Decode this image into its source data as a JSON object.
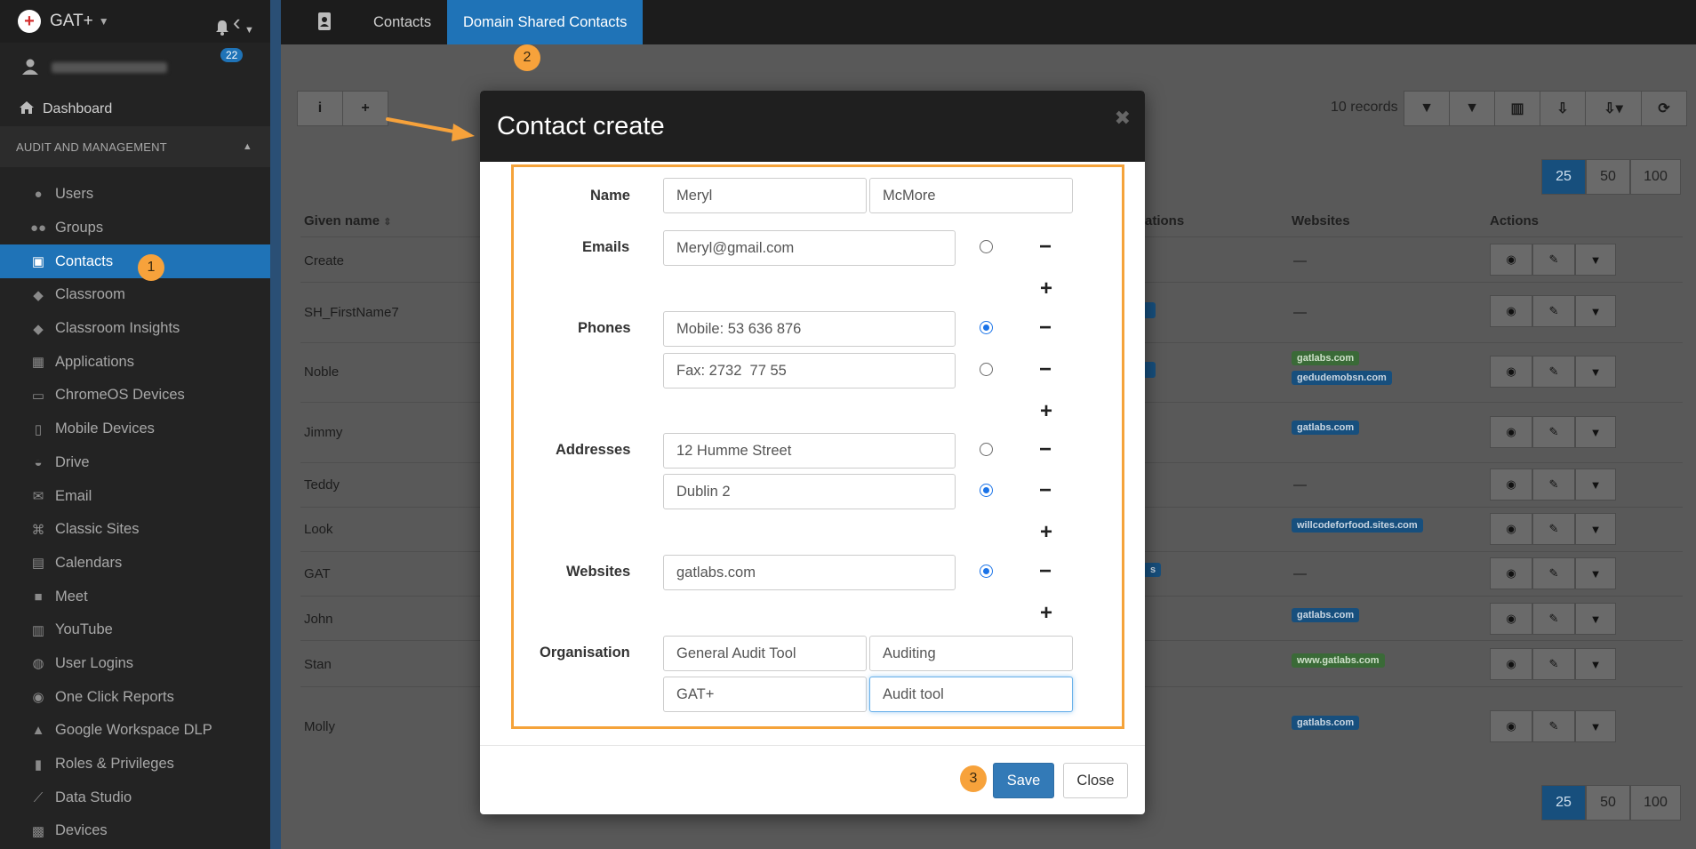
{
  "app": {
    "name": "GAT+",
    "notifications": "22"
  },
  "sidebar": {
    "dashboard": "Dashboard",
    "section": "AUDIT AND MANAGEMENT",
    "items": [
      {
        "label": "Users",
        "icon": "user-icon"
      },
      {
        "label": "Groups",
        "icon": "groups-icon"
      },
      {
        "label": "Contacts",
        "icon": "contact-card-icon",
        "active": true
      },
      {
        "label": "Classroom",
        "icon": "graduation-cap-icon"
      },
      {
        "label": "Classroom Insights",
        "icon": "classroom-insights-icon"
      },
      {
        "label": "Applications",
        "icon": "grid-icon"
      },
      {
        "label": "ChromeOS Devices",
        "icon": "laptop-icon"
      },
      {
        "label": "Mobile Devices",
        "icon": "mobile-icon"
      },
      {
        "label": "Drive",
        "icon": "drive-icon"
      },
      {
        "label": "Email",
        "icon": "envelope-icon"
      },
      {
        "label": "Classic Sites",
        "icon": "sitemap-icon"
      },
      {
        "label": "Calendars",
        "icon": "calendar-icon"
      },
      {
        "label": "Meet",
        "icon": "video-icon"
      },
      {
        "label": "YouTube",
        "icon": "film-icon"
      },
      {
        "label": "User Logins",
        "icon": "globe-icon"
      },
      {
        "label": "One Click Reports",
        "icon": "eye-icon"
      },
      {
        "label": "Google Workspace DLP",
        "icon": "flask-icon"
      },
      {
        "label": "Roles & Privileges",
        "icon": "lock-icon"
      },
      {
        "label": "Data Studio",
        "icon": "line-chart-icon"
      },
      {
        "label": "Devices",
        "icon": "chip-icon"
      }
    ]
  },
  "topbar": {
    "tabs": [
      "Contacts",
      "Domain Shared Contacts"
    ]
  },
  "main": {
    "records": "10 records",
    "page_sizes": [
      "25",
      "50",
      "100"
    ],
    "columns": {
      "given_name": "Given name",
      "organisations": "ations",
      "websites": "Websites",
      "actions": "Actions"
    },
    "rows": [
      {
        "name": "Create",
        "website": "—"
      },
      {
        "name": "SH_FirstName7",
        "website": "—"
      },
      {
        "name": "Noble",
        "websites": [
          "gatlabs.com",
          "gedudemobsn.com"
        ]
      },
      {
        "name": "Jimmy",
        "websites": [
          "gatlabs.com"
        ]
      },
      {
        "name": "Teddy",
        "website": "—"
      },
      {
        "name": "Look",
        "websites": [
          "willcodeforfood.sites.com"
        ]
      },
      {
        "name": "GAT",
        "website": "—"
      },
      {
        "name": "John",
        "websites": [
          "gatlabs.com"
        ]
      },
      {
        "name": "Stan",
        "websites": [
          "www.gatlabs.com"
        ]
      },
      {
        "name": "Molly",
        "websites": [
          "gatlabs.com"
        ]
      }
    ],
    "gat_org_fragment": "s"
  },
  "modal": {
    "title": "Contact create",
    "labels": {
      "name": "Name",
      "emails": "Emails",
      "phones": "Phones",
      "addresses": "Addresses",
      "websites": "Websites",
      "organisation": "Organisation"
    },
    "name": {
      "first": "Meryl",
      "last": "McMore"
    },
    "emails": [
      {
        "value": "Meryl@gmail.com",
        "primary": false
      }
    ],
    "phones": [
      {
        "value": "Mobile: 53 636 876",
        "primary": true
      },
      {
        "value": "Fax: 2732  77 55",
        "primary": false
      }
    ],
    "addresses": [
      {
        "value": "12 Humme Street",
        "primary": false
      },
      {
        "value": "Dublin 2",
        "primary": true
      }
    ],
    "websites": [
      {
        "value": "gatlabs.com",
        "primary": true
      }
    ],
    "organisation": {
      "name": "General Audit Tool",
      "department": "Auditing",
      "name2": "GAT+",
      "title": "Audit tool"
    },
    "save": "Save",
    "close": "Close"
  },
  "steps": [
    "1",
    "2",
    "3"
  ],
  "colors": {
    "accent": "#1f73b7",
    "step": "#f7a23b",
    "highlight_border": "#f5a33a",
    "save": "#337ab7"
  }
}
